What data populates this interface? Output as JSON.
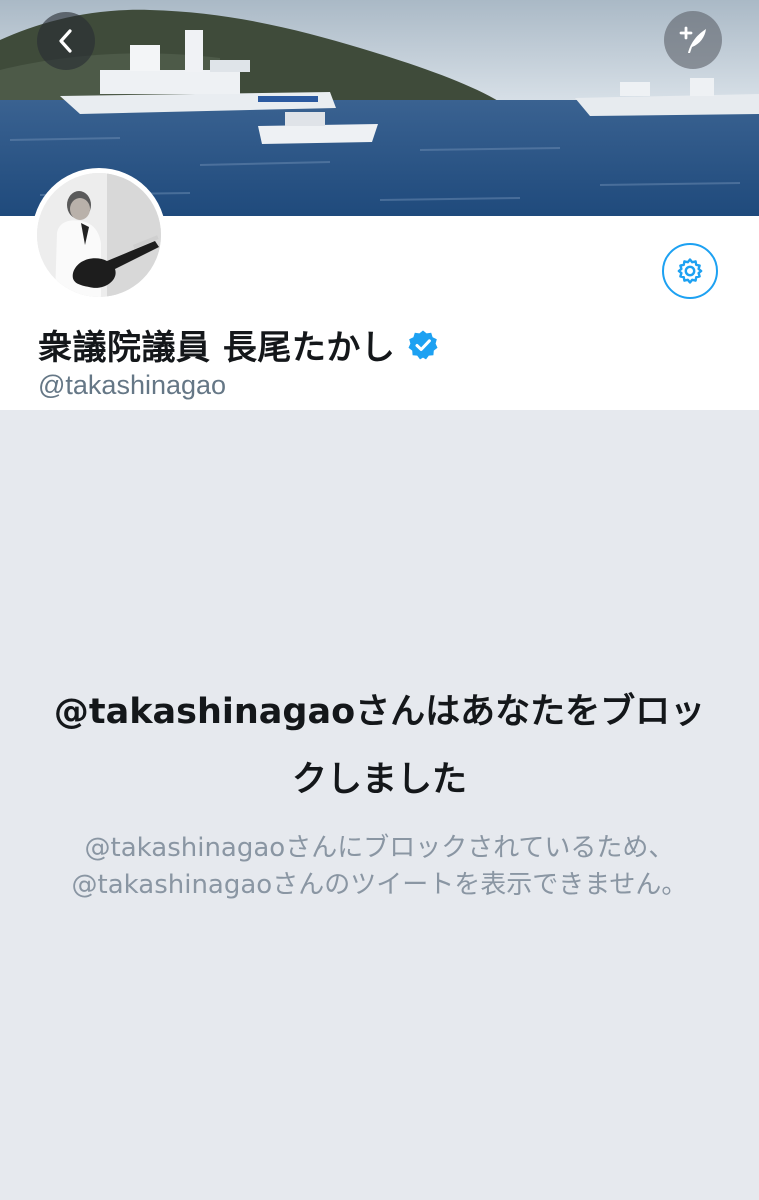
{
  "header": {
    "back_icon": "chevron-left-icon",
    "compose_icon": "compose-tweet-icon"
  },
  "profile": {
    "display_name": "衆議院議員 長尾たかし",
    "handle": "@takashinagao",
    "verified": true,
    "settings_icon": "gear-icon"
  },
  "blocked": {
    "title": "@takashinagaoさんはあなたをブロックしました",
    "description": "@takashinagaoさんにブロックされているため、@takashinagaoさんのツイートを表示できません。"
  },
  "colors": {
    "accent": "#1da1f2",
    "background": "#e6e9ee",
    "name_text": "#14171a",
    "secondary_text": "#657786"
  }
}
